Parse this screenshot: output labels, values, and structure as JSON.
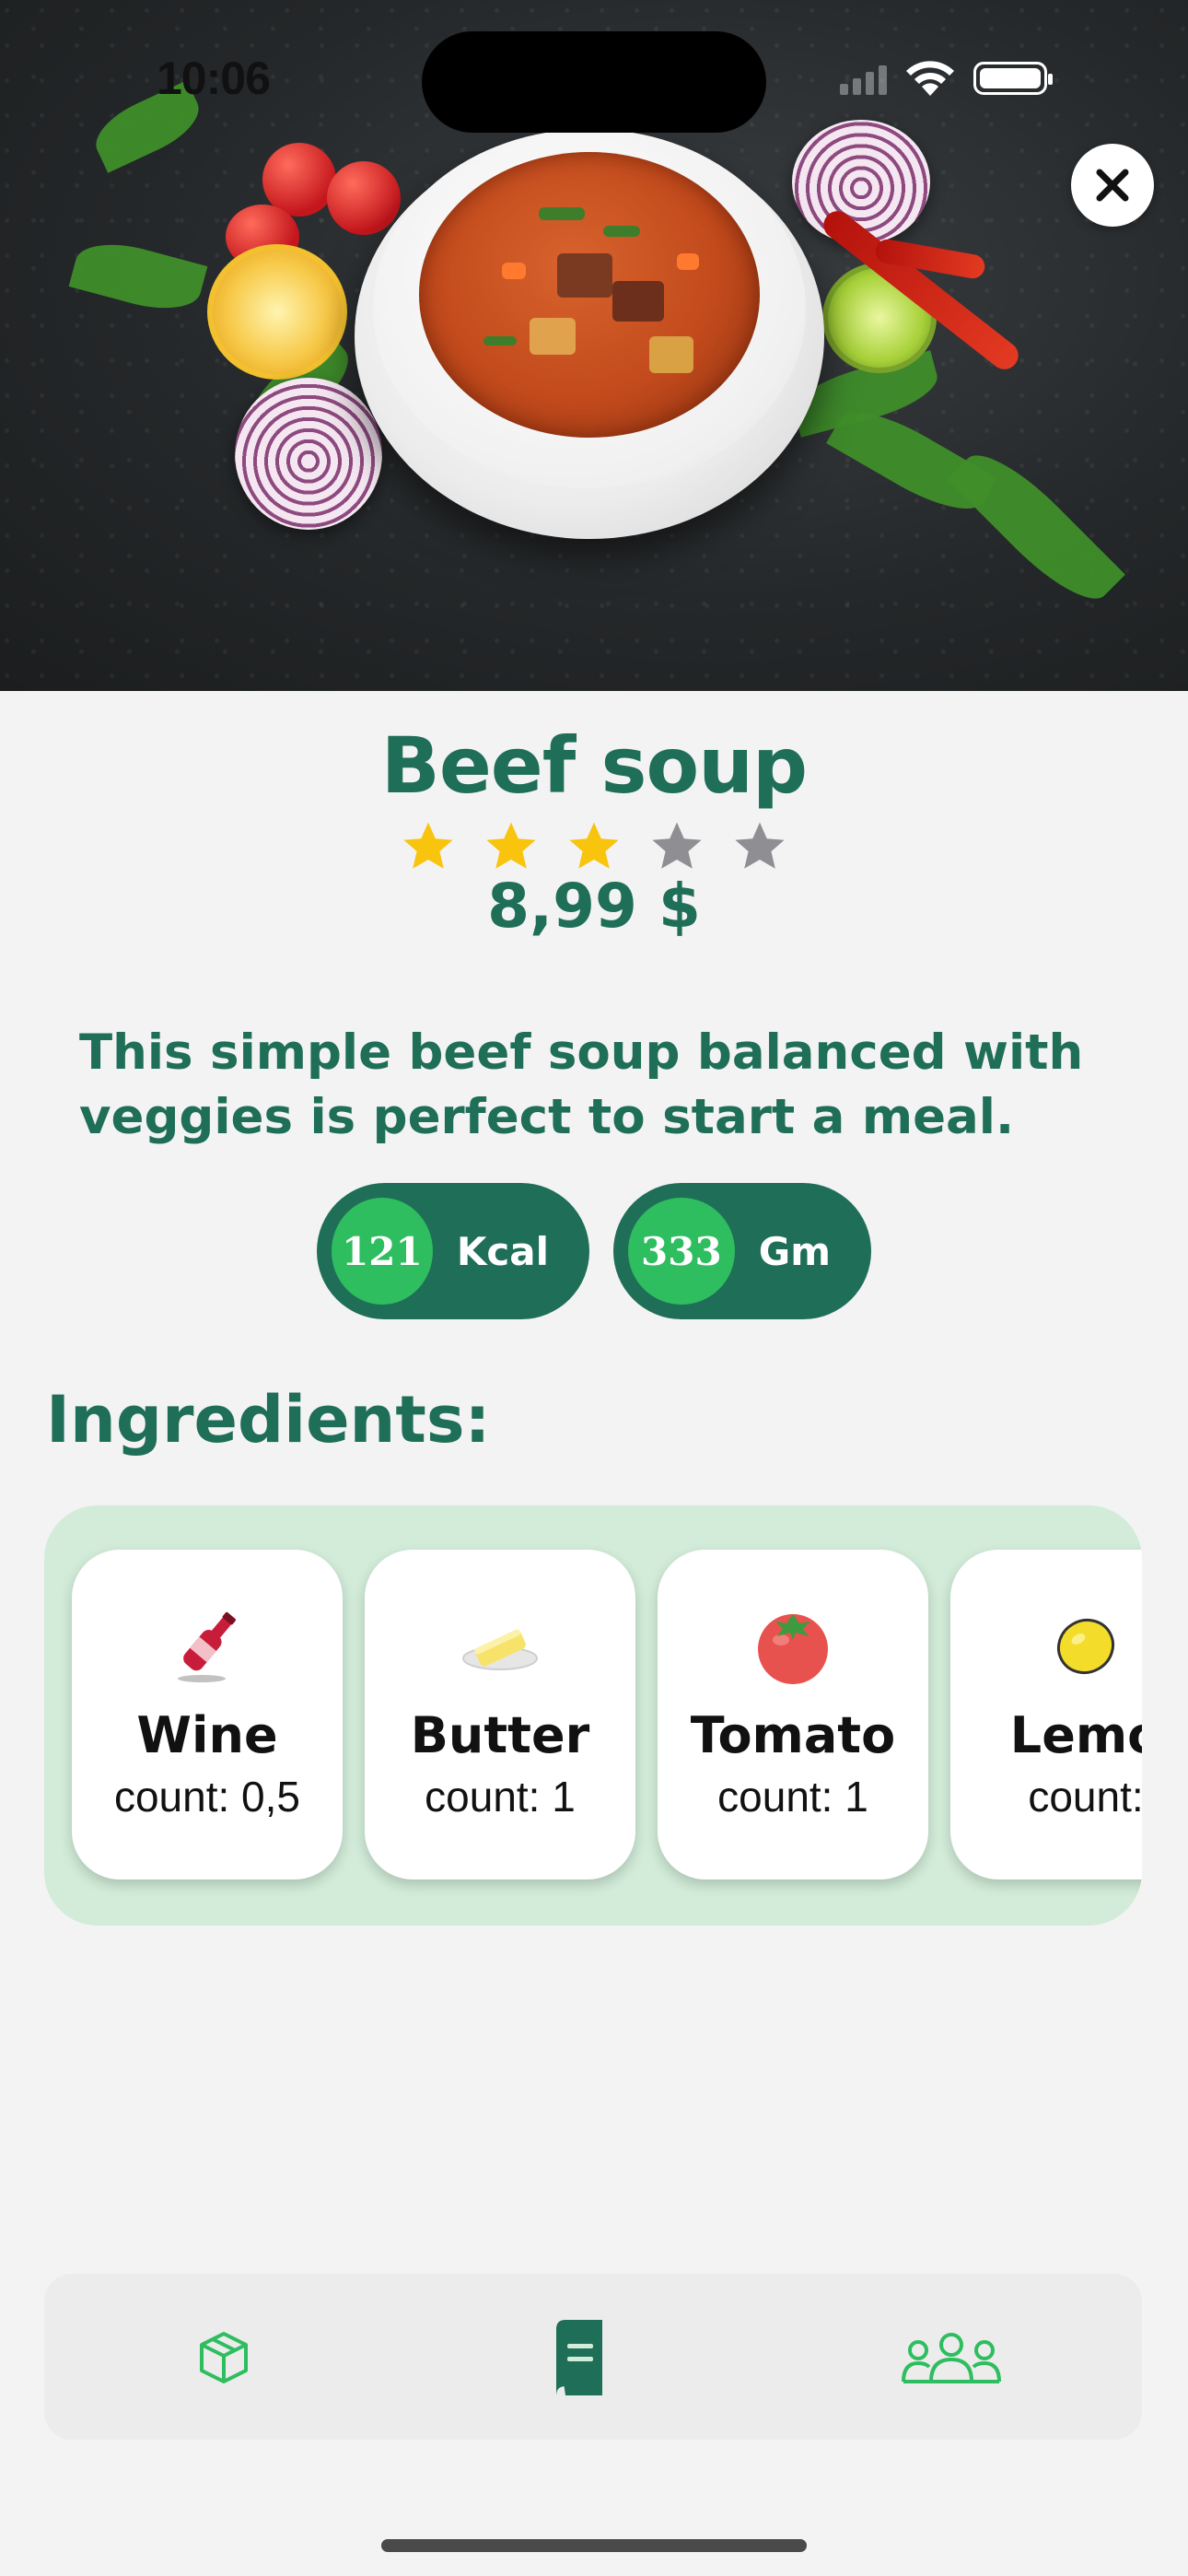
{
  "status_bar": {
    "time": "10:06"
  },
  "dish": {
    "title": "Beef soup",
    "rating": 3,
    "rating_max": 5,
    "price": "8,99 $",
    "description": "This simple beef soup balanced with veggies is perfect to start a meal."
  },
  "nutrition": [
    {
      "value": "121",
      "unit": "Kcal"
    },
    {
      "value": "333",
      "unit": "Gm"
    }
  ],
  "ingredients": {
    "heading": "Ingredients:",
    "items": [
      {
        "name": "Wine",
        "count": "count: 0,5",
        "icon": "wine-bottle-icon"
      },
      {
        "name": "Butter",
        "count": "count: 1",
        "icon": "butter-icon"
      },
      {
        "name": "Tomato",
        "count": "count: 1",
        "icon": "tomato-icon"
      },
      {
        "name": "Lemo",
        "count": "count:",
        "icon": "lemon-icon"
      }
    ]
  },
  "tab_bar": {
    "items": [
      {
        "icon": "box-icon",
        "active": false
      },
      {
        "icon": "book-icon",
        "active": true
      },
      {
        "icon": "users-icon",
        "active": false
      }
    ]
  },
  "colors": {
    "primary": "#1f6e57",
    "accent_green": "#2ebd5f",
    "star_filled": "#f8c40d",
    "star_empty": "#8e8e93",
    "panel_bg": "#d2ecd9",
    "page_bg": "#f3f3f3"
  }
}
